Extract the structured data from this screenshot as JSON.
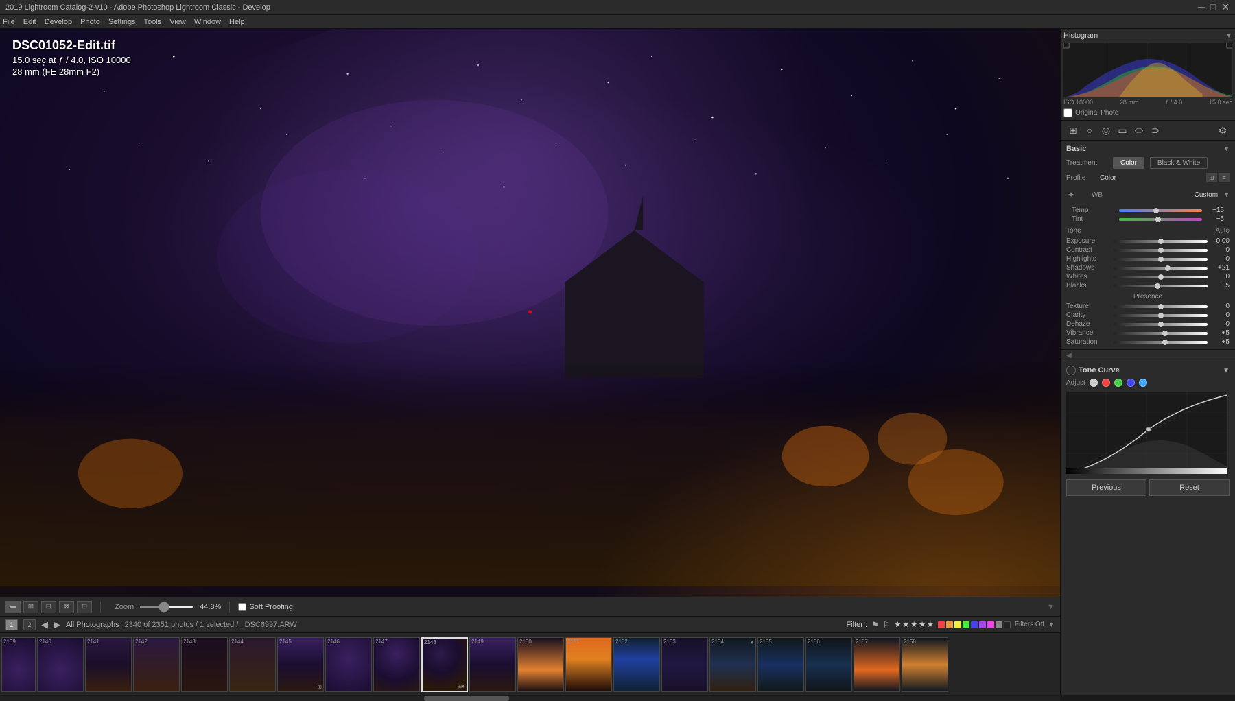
{
  "titlebar": {
    "title": "2019 Lightroom Catalog-2-v10 - Adobe Photoshop Lightroom Classic - Develop",
    "minimize": "─",
    "maximize": "□",
    "close": "✕"
  },
  "menubar": {
    "items": [
      "File",
      "Edit",
      "Develop",
      "Photo",
      "Settings",
      "Tools",
      "View",
      "Window",
      "Help"
    ]
  },
  "photo": {
    "title": "DSC01052-Edit.tif",
    "info1": "15.0 sec at ƒ / 4.0, ISO 10000",
    "info2": "28 mm (FE 28mm F2)"
  },
  "toolbar": {
    "zoom_label": "Zoom",
    "zoom_value": "44.8%",
    "soft_proofing": "Soft Proofing"
  },
  "filmstrip": {
    "page1": "1",
    "page2": "2",
    "source": "All Photographs",
    "count": "2340 of 2351 photos / 1 selected / _DSC6997.ARW",
    "filter_label": "Filter :",
    "filters_off": "Filters Off",
    "thumbnails": [
      {
        "num": "2139",
        "active": false
      },
      {
        "num": "2140",
        "active": false
      },
      {
        "num": "2141",
        "active": false
      },
      {
        "num": "2142",
        "active": false
      },
      {
        "num": "2143",
        "active": false
      },
      {
        "num": "2144",
        "active": false
      },
      {
        "num": "2145",
        "active": false
      },
      {
        "num": "2146",
        "active": false
      },
      {
        "num": "2147",
        "active": false
      },
      {
        "num": "2148",
        "active": true
      },
      {
        "num": "2149",
        "active": false
      },
      {
        "num": "2150",
        "active": false
      },
      {
        "num": "2151",
        "active": false
      },
      {
        "num": "2152",
        "active": false
      },
      {
        "num": "2153",
        "active": false
      },
      {
        "num": "2154",
        "active": false
      },
      {
        "num": "2155",
        "active": false
      },
      {
        "num": "2156",
        "active": false
      },
      {
        "num": "2157",
        "active": false
      },
      {
        "num": "2158",
        "active": false
      }
    ]
  },
  "right_panel": {
    "histogram": {
      "title": "Histogram",
      "iso": "ISO 10000",
      "focal": "28 mm",
      "aperture": "ƒ / 4.0",
      "shutter": "15.0 sec",
      "original_photo": "Original Photo"
    },
    "basic": {
      "title": "Basic",
      "treatment_label": "Treatment",
      "color_btn": "Color",
      "bw_btn": "Black & White",
      "profile_label": "Profile",
      "profile_value": "Color",
      "wb_label": "WB",
      "wb_value": "Custom",
      "tone_label": "Tone",
      "tone_auto": "Auto",
      "sliders": {
        "temp": {
          "label": "Temp",
          "value": "−15",
          "position": 45
        },
        "tint": {
          "label": "Tint",
          "value": "−5",
          "position": 47
        },
        "exposure": {
          "label": "Exposure",
          "value": "0.00",
          "position": 50
        },
        "contrast": {
          "label": "Contrast",
          "value": "0",
          "position": 50
        },
        "highlights": {
          "label": "Highlights",
          "value": "0",
          "position": 50
        },
        "shadows": {
          "label": "Shadows",
          "value": "+21",
          "position": 58
        },
        "whites": {
          "label": "Whites",
          "value": "0",
          "position": 50
        },
        "blacks": {
          "label": "Blacks",
          "value": "−5",
          "position": 47
        }
      },
      "presence_label": "Presence",
      "presence": {
        "texture": {
          "label": "Texture",
          "value": "0",
          "position": 50
        },
        "clarity": {
          "label": "Clarity",
          "value": "0",
          "position": 50
        },
        "dehaze": {
          "label": "Dehaze",
          "value": "0",
          "position": 50
        },
        "vibrance": {
          "label": "Vibrance",
          "value": "+5",
          "position": 55
        },
        "saturation": {
          "label": "Saturation",
          "value": "+5",
          "position": 55
        }
      }
    },
    "tone_curve": {
      "title": "Tone Curve",
      "adjust_label": "Adjust",
      "channels": [
        "white",
        "#e44",
        "#4c4",
        "#44e",
        "#4af"
      ],
      "prev_btn": "Previous",
      "reset_btn": "Reset"
    }
  }
}
